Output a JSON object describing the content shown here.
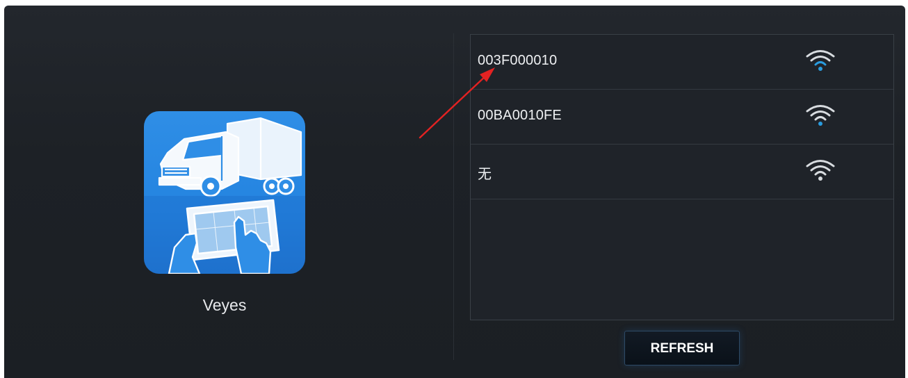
{
  "app": {
    "name": "Veyes",
    "icon": "truck-tablet-app-icon"
  },
  "devices": [
    {
      "label": "003F000010",
      "icon": "wifi-signal-icon"
    },
    {
      "label": "00BA0010FE",
      "icon": "wifi-signal-icon"
    },
    {
      "label": "无",
      "icon": "wifi-signal-icon"
    }
  ],
  "actions": {
    "refresh_label": "REFRESH"
  },
  "colors": {
    "wifi_active": "#2a9cdf",
    "wifi_inactive": "#d8dce0",
    "annotation_arrow": "#e32222",
    "app_icon_blue": "#2f8ee6"
  }
}
